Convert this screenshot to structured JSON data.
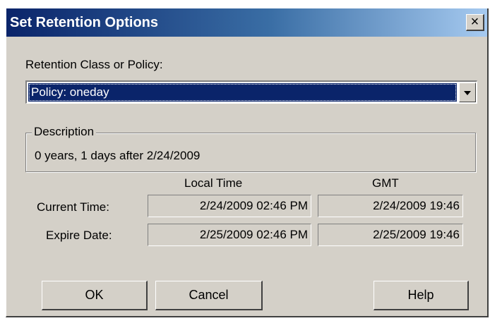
{
  "dialog": {
    "title": "Set Retention Options",
    "close_label": "×"
  },
  "retention": {
    "label": "Retention Class or Policy:",
    "selected": "Policy: oneday"
  },
  "description": {
    "legend": "Description",
    "text": "0 years, 1 days after 2/24/2009"
  },
  "times": {
    "col_local": "Local Time",
    "col_gmt": "GMT",
    "current_label": "Current Time:",
    "current_local": "2/24/2009 02:46 PM",
    "current_gmt": "2/24/2009 19:46",
    "expire_label": "Expire Date:",
    "expire_local": "2/25/2009 02:46 PM",
    "expire_gmt": "2/25/2009 19:46"
  },
  "buttons": {
    "ok": "OK",
    "cancel": "Cancel",
    "help": "Help"
  },
  "icons": {
    "close": "close-icon",
    "dropdown": "chevron-down-icon"
  }
}
